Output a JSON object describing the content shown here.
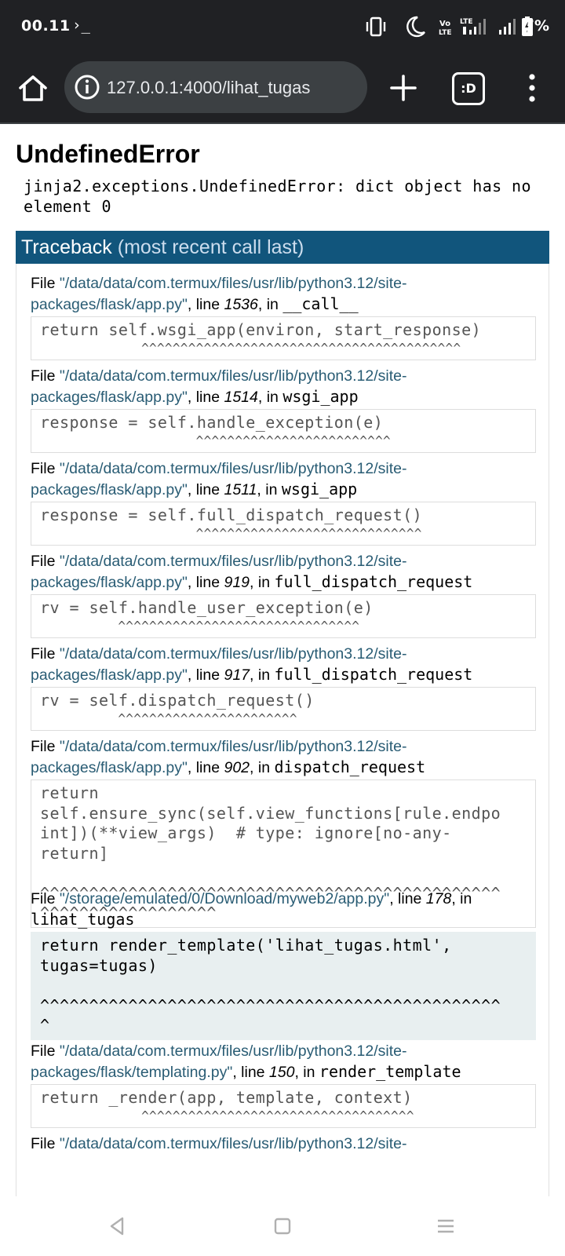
{
  "status_bar": {
    "time": "00.11",
    "terminal_glyph": "›_",
    "battery_percent": "7%",
    "icons": [
      "vibrate-icon",
      "moon-icon",
      "volte-icon",
      "lte-signal-icon",
      "signal-icon",
      "battery-icon"
    ],
    "volte_label": "Vo LTE",
    "lte_label": "LTE"
  },
  "browser": {
    "url": "127.0.0.1:4000/lihat_tugas",
    "tabs_label": ":D",
    "icons": [
      "home-icon",
      "info-icon",
      "plus-icon",
      "tabs-icon",
      "more-vert-icon"
    ]
  },
  "page": {
    "title": "UndefinedError",
    "message": "jinja2.exceptions.UndefinedError: dict object has no element 0",
    "traceback_label": "Traceback",
    "traceback_note": "(most recent call last)",
    "frames": [
      {
        "file_prefix": "File ",
        "file_line1": "\"/data/data/com.termux/files/usr/lib/python3.12/site-",
        "file_line2": "packages/flask/app.py\"",
        "line_prefix": ", line ",
        "line": "1536",
        "in_prefix": ", in ",
        "func": "__call__",
        "code_lines": [
          "return self.wsgi_app(environ, start_response)"
        ],
        "caret": "             ^^^^^^^^^^^^^^^^^^^^^^^^^^^^^^^^^^^^^^^^^"
      },
      {
        "file_prefix": "File ",
        "file_line1": "\"/data/data/com.termux/files/usr/lib/python3.12/site-",
        "file_line2": "packages/flask/app.py\"",
        "line_prefix": ", line ",
        "line": "1514",
        "in_prefix": ", in ",
        "func": "wsgi_app",
        "code_lines": [
          "response = self.handle_exception(e)"
        ],
        "caret": "                    ^^^^^^^^^^^^^^^^^^^^^^^^^"
      },
      {
        "file_prefix": "File ",
        "file_line1": "\"/data/data/com.termux/files/usr/lib/python3.12/site-",
        "file_line2": "packages/flask/app.py\"",
        "line_prefix": ", line ",
        "line": "1511",
        "in_prefix": ", in ",
        "func": "wsgi_app",
        "code_lines": [
          "response = self.full_dispatch_request()"
        ],
        "caret": "                    ^^^^^^^^^^^^^^^^^^^^^^^^^^^^^"
      },
      {
        "file_prefix": "File ",
        "file_line1": "\"/data/data/com.termux/files/usr/lib/python3.12/site-",
        "file_line2": "packages/flask/app.py\"",
        "line_prefix": ", line ",
        "line": "919",
        "in_prefix": ", in ",
        "func": "full_dispatch_request",
        "code_lines": [
          "rv = self.handle_user_exception(e)"
        ],
        "caret": "          ^^^^^^^^^^^^^^^^^^^^^^^^^^^^^^^"
      },
      {
        "file_prefix": "File ",
        "file_line1": "\"/data/data/com.termux/files/usr/lib/python3.12/site-",
        "file_line2": "packages/flask/app.py\"",
        "line_prefix": ", line ",
        "line": "917",
        "in_prefix": ", in ",
        "func": "full_dispatch_request",
        "code_lines": [
          "rv = self.dispatch_request()"
        ],
        "caret": "          ^^^^^^^^^^^^^^^^^^^^^^^"
      },
      {
        "file_prefix": "File ",
        "file_line1": "\"/data/data/com.termux/files/usr/lib/python3.12/site-",
        "file_line2": "packages/flask/app.py\"",
        "line_prefix": ", line ",
        "line": "902",
        "in_prefix": ", in ",
        "func": "dispatch_request",
        "code_lines": [
          "return",
          "self.ensure_sync(self.view_functions[rule.endpo",
          "int])(**view_args)  # type: ignore[no-any-",
          "return]",
          "",
          "^^^^^^^^^^^^^^^^^^^^^^^^^^^^^^^^^^^^^^^^^^^^^^^",
          "^^^^^^^^^^^^^^^^^^"
        ]
      },
      {
        "file_prefix": "File ",
        "file_line1": "\"/storage/emulated/0/Download/myweb2/app.py\"",
        "line_prefix": ", line ",
        "line": "178",
        "in_prefix": ", in",
        "func": "lihat_tugas",
        "current": true,
        "code_lines": [
          "return render_template('lihat_tugas.html',",
          "tugas=tugas)",
          "",
          "^^^^^^^^^^^^^^^^^^^^^^^^^^^^^^^^^^^^^^^^^^^^^^^",
          "^"
        ]
      },
      {
        "file_prefix": "File ",
        "file_line1": "\"/data/data/com.termux/files/usr/lib/python3.12/site-",
        "file_line2": "packages/flask/templating.py\"",
        "line_prefix": ", line ",
        "line": "150",
        "in_prefix": ", in ",
        "func": "render_template",
        "code_lines": [
          "return _render(app, template, context)"
        ],
        "caret": "             ^^^^^^^^^^^^^^^^^^^^^^^^^^^^^^^^^^^"
      },
      {
        "file_prefix": "File ",
        "file_line1": "\"/data/data/com.termux/files/usr/lib/python3.12/site-"
      }
    ]
  },
  "nav_bar": {
    "icons": [
      "back-icon",
      "home-square-icon",
      "recents-icon"
    ]
  },
  "colors": {
    "chrome_bg": "#202124",
    "omnibox_bg": "#3c4043",
    "traceback_header": "#11557c",
    "filename": "#295c74",
    "current_frame_bg": "#e8eff0"
  }
}
